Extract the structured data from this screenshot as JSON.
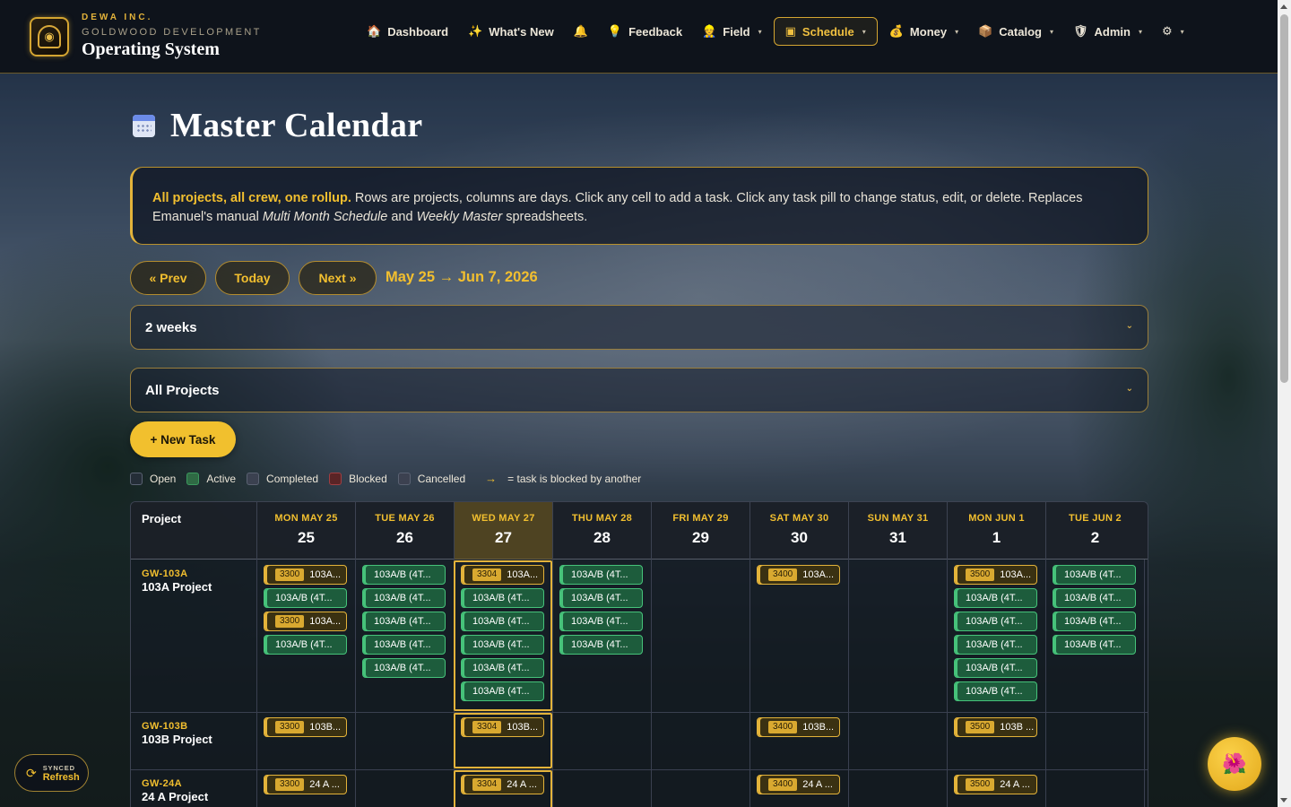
{
  "brand": {
    "company": "DEWA INC.",
    "subtitle": "GOLDWOOD DEVELOPMENT",
    "title": "Operating System"
  },
  "nav": {
    "items": [
      {
        "label": "Dashboard",
        "icon": "house-icon",
        "glyph": "🏠",
        "dropdown": false
      },
      {
        "label": "What's New",
        "icon": "sparkle-icon",
        "glyph": "✨",
        "dropdown": false
      },
      {
        "label": "",
        "icon": "bell-icon",
        "glyph": "🔔",
        "dropdown": false
      },
      {
        "label": "Feedback",
        "icon": "lightbulb-icon",
        "glyph": "💡",
        "dropdown": false
      },
      {
        "label": "Field",
        "icon": "worker-icon",
        "glyph": "👷",
        "dropdown": true
      },
      {
        "label": "Schedule",
        "icon": "calendar-icon",
        "glyph": "▣",
        "dropdown": true,
        "active": true
      },
      {
        "label": "Money",
        "icon": "money-bag-icon",
        "glyph": "💰",
        "dropdown": true
      },
      {
        "label": "Catalog",
        "icon": "box-icon",
        "glyph": "📦",
        "dropdown": true
      },
      {
        "label": "Admin",
        "icon": "shield-icon",
        "glyph": "🛡",
        "dropdown": true
      },
      {
        "label": "",
        "icon": "gear-icon",
        "glyph": "⚙",
        "dropdown": true
      }
    ]
  },
  "page": {
    "title": "Master Calendar",
    "info_highlight": "All projects, all crew, one rollup.",
    "info_text_1": " Rows are projects, columns are days. Click any cell to add a task. Click any task pill to change status, edit, or delete. Replaces Emanuel's manual ",
    "info_em_1": "Multi Month Schedule",
    "info_text_2": " and ",
    "info_em_2": "Weekly Master",
    "info_text_3": " spreadsheets."
  },
  "controls": {
    "prev_label": "« Prev",
    "today_label": "Today",
    "next_label": "Next »",
    "range_label": "May 25 → Jun 7, 2026",
    "view_select": "2 weeks",
    "project_select": "All Projects",
    "new_task_label": "+ New Task"
  },
  "legend": {
    "items": [
      {
        "label": "Open",
        "status": "open"
      },
      {
        "label": "Active",
        "status": "active"
      },
      {
        "label": "Completed",
        "status": "completed"
      },
      {
        "label": "Blocked",
        "status": "blocked"
      },
      {
        "label": "Cancelled",
        "status": "cancelled"
      }
    ],
    "arrow": "→",
    "arrow_text": "= task is blocked by another"
  },
  "calendar": {
    "project_header": "Project",
    "days": [
      {
        "dow": "MON MAY 25",
        "num": "25",
        "today": false
      },
      {
        "dow": "TUE MAY 26",
        "num": "26",
        "today": false
      },
      {
        "dow": "WED MAY 27",
        "num": "27",
        "today": true
      },
      {
        "dow": "THU MAY 28",
        "num": "28",
        "today": false
      },
      {
        "dow": "FRI MAY 29",
        "num": "29",
        "today": false
      },
      {
        "dow": "SAT MAY 30",
        "num": "30",
        "today": false
      },
      {
        "dow": "SUN MAY 31",
        "num": "31",
        "today": false
      },
      {
        "dow": "MON JUN 1",
        "num": "1",
        "today": false
      },
      {
        "dow": "TUE JUN 2",
        "num": "2",
        "today": false
      }
    ],
    "rows": [
      {
        "code": "GW-103A",
        "name": "103A Project",
        "cells": [
          [
            {
              "t": "gold",
              "code": "3300",
              "text": "103A..."
            },
            {
              "t": "green",
              "text": "103A/B (4T..."
            },
            {
              "t": "gold",
              "code": "3300",
              "text": "103A..."
            },
            {
              "t": "green",
              "text": "103A/B (4T..."
            }
          ],
          [
            {
              "t": "green",
              "text": "103A/B (4T..."
            },
            {
              "t": "green",
              "text": "103A/B (4T..."
            },
            {
              "t": "green",
              "text": "103A/B (4T..."
            },
            {
              "t": "green",
              "text": "103A/B (4T..."
            },
            {
              "t": "green",
              "text": "103A/B (4T..."
            }
          ],
          [
            {
              "t": "gold",
              "code": "3304",
              "text": "103A..."
            },
            {
              "t": "green",
              "text": "103A/B (4T..."
            },
            {
              "t": "green",
              "text": "103A/B (4T..."
            },
            {
              "t": "green",
              "text": "103A/B (4T..."
            },
            {
              "t": "green",
              "text": "103A/B (4T..."
            },
            {
              "t": "green",
              "text": "103A/B (4T..."
            }
          ],
          [
            {
              "t": "green",
              "text": "103A/B (4T..."
            },
            {
              "t": "green",
              "text": "103A/B (4T..."
            },
            {
              "t": "green",
              "text": "103A/B (4T..."
            },
            {
              "t": "green",
              "text": "103A/B (4T..."
            }
          ],
          [],
          [
            {
              "t": "gold",
              "code": "3400",
              "text": "103A..."
            }
          ],
          [],
          [
            {
              "t": "gold",
              "code": "3500",
              "text": "103A..."
            },
            {
              "t": "green",
              "text": "103A/B (4T..."
            },
            {
              "t": "green",
              "text": "103A/B (4T..."
            },
            {
              "t": "green",
              "text": "103A/B (4T..."
            },
            {
              "t": "green",
              "text": "103A/B (4T..."
            },
            {
              "t": "green",
              "text": "103A/B (4T..."
            }
          ],
          [
            {
              "t": "green",
              "text": "103A/B (4T..."
            },
            {
              "t": "green",
              "text": "103A/B (4T..."
            },
            {
              "t": "green",
              "text": "103A/B (4T..."
            },
            {
              "t": "green",
              "text": "103A/B (4T..."
            }
          ]
        ]
      },
      {
        "code": "GW-103B",
        "name": "103B Project",
        "cells": [
          [
            {
              "t": "gold",
              "code": "3300",
              "text": "103B..."
            }
          ],
          [],
          [
            {
              "t": "gold",
              "code": "3304",
              "text": "103B..."
            }
          ],
          [],
          [],
          [
            {
              "t": "gold",
              "code": "3400",
              "text": "103B..."
            }
          ],
          [],
          [
            {
              "t": "gold",
              "code": "3500",
              "text": "103B ..."
            }
          ],
          []
        ]
      },
      {
        "code": "GW-24A",
        "name": "24 A Project",
        "cells": [
          [
            {
              "t": "gold",
              "code": "3300",
              "text": "24 A ..."
            }
          ],
          [],
          [
            {
              "t": "gold",
              "code": "3304",
              "text": "24 A ..."
            }
          ],
          [],
          [],
          [
            {
              "t": "gold",
              "code": "3400",
              "text": "24 A ..."
            }
          ],
          [],
          [
            {
              "t": "gold",
              "code": "3500",
              "text": "24 A ..."
            }
          ],
          []
        ]
      }
    ]
  },
  "sync": {
    "status": "SYNCED",
    "action": "Refresh"
  },
  "fab": {
    "icon": "hibiscus-icon",
    "glyph": "🌺"
  },
  "colors": {
    "accent": "#f2bf2f",
    "active_green": "#46c27a",
    "navbar_bg": "#0e131b"
  }
}
